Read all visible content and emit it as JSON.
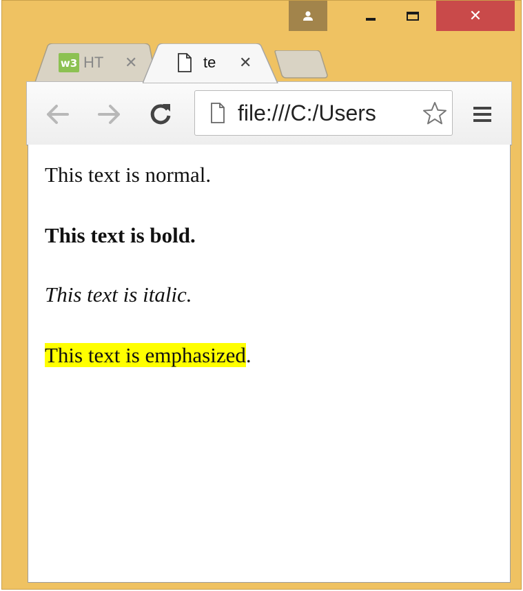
{
  "window": {
    "controls": {
      "close_glyph": "✕"
    }
  },
  "tabs": [
    {
      "label": "HT",
      "close_glyph": "✕",
      "favicon": "w3-icon",
      "active": false
    },
    {
      "label": "te",
      "close_glyph": "✕",
      "favicon": "page-icon",
      "active": true
    }
  ],
  "toolbar": {
    "back_icon": "back-arrow-icon",
    "forward_icon": "forward-arrow-icon",
    "reload_icon": "reload-icon",
    "url": "file:///C:/Users",
    "menu_icon": "hamburger-menu-icon"
  },
  "page": {
    "normal": "This text is normal.",
    "bold": "This text is bold.",
    "italic": "This text is italic.",
    "emphasized": "This text is emphasized",
    "emphasized_period": "."
  },
  "colors": {
    "frame": "#efc262",
    "close_button": "#c94a4a",
    "profile_button": "#a2844b",
    "highlight": "#ffff00"
  }
}
